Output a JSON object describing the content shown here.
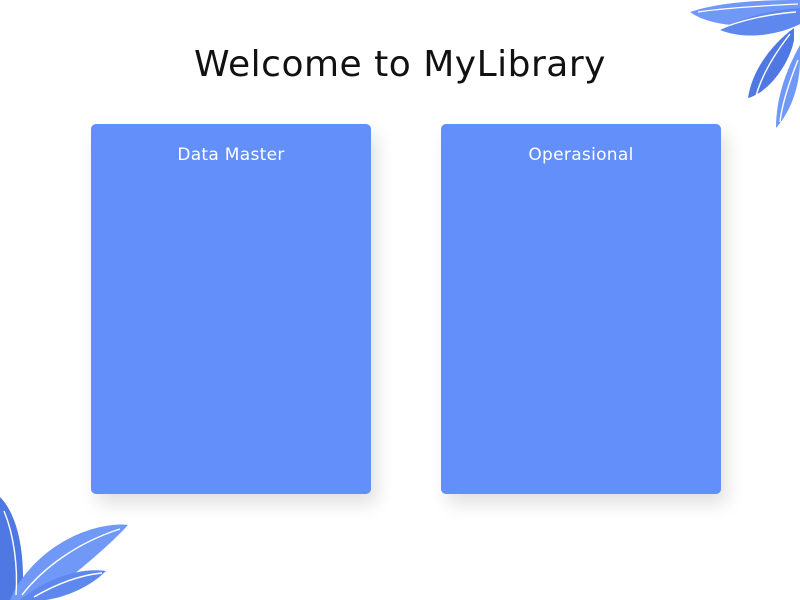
{
  "header": {
    "title": "Welcome to MyLibrary"
  },
  "cards": [
    {
      "label": "Data Master"
    },
    {
      "label": "Operasional"
    }
  ],
  "decorations": {
    "top_right": "leaf-icon",
    "bottom_left": "leaf-icon"
  },
  "colors": {
    "card": "#628ff9",
    "leaf_light": "#6f98f7",
    "leaf_dark": "#4f78e3",
    "title": "#111111"
  }
}
